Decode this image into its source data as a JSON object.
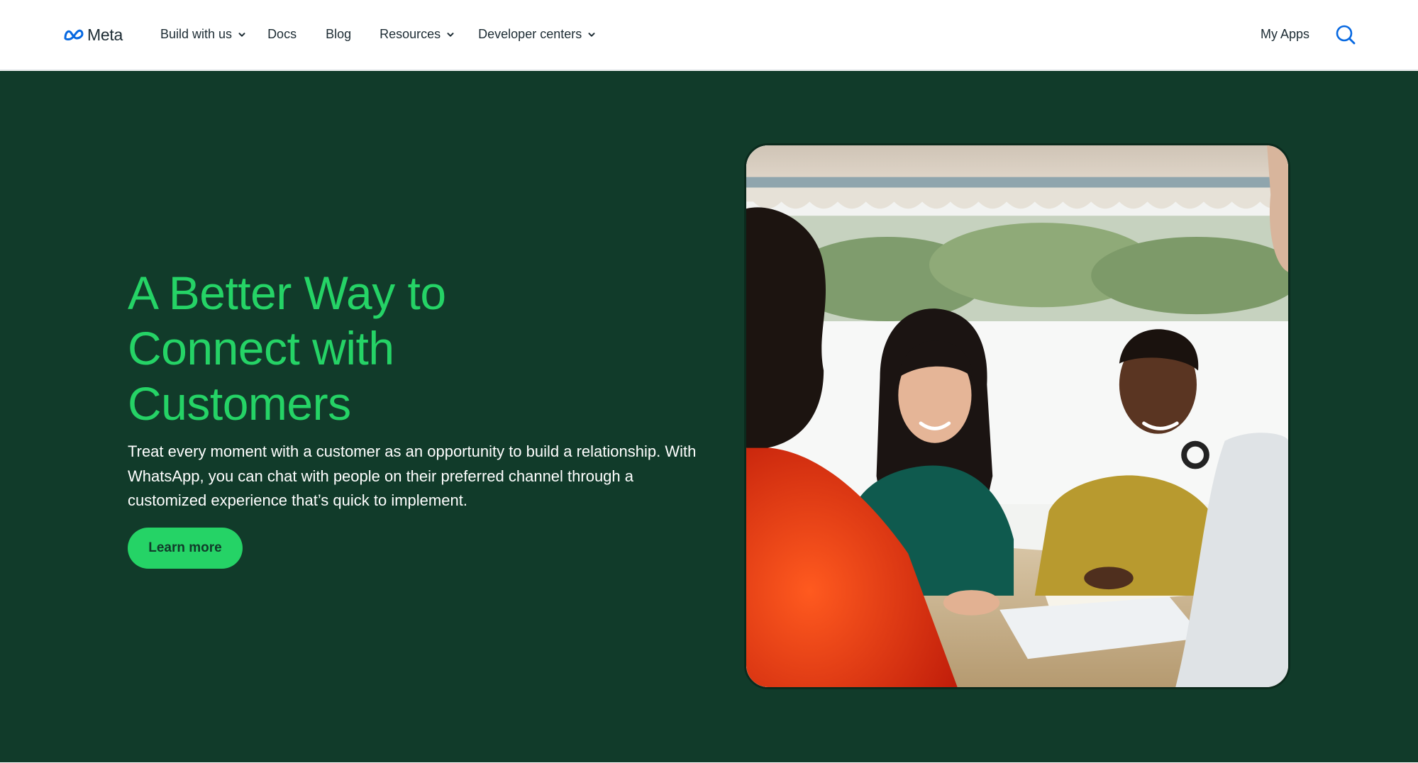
{
  "nav": {
    "brand": "Meta",
    "items": [
      {
        "label": "Build with us",
        "has_dropdown": true
      },
      {
        "label": "Docs",
        "has_dropdown": false
      },
      {
        "label": "Blog",
        "has_dropdown": false
      },
      {
        "label": "Resources",
        "has_dropdown": true
      },
      {
        "label": "Developer centers",
        "has_dropdown": true
      }
    ],
    "my_apps": "My Apps",
    "search_icon": "search-icon"
  },
  "hero": {
    "title": "A Better Way to Connect with Customers",
    "body": "Treat every moment with a customer as an opportunity to build a relationship. With WhatsApp, you can chat with people on their preferred channel through a customized experience that’s quick to implement.",
    "cta_label": "Learn more",
    "image_alt": "Three people smiling and working together at a table"
  },
  "colors": {
    "hero_background": "#113b2a",
    "accent_green": "#25d366",
    "nav_text": "#1c2b33",
    "meta_blue": "#0668e1"
  }
}
